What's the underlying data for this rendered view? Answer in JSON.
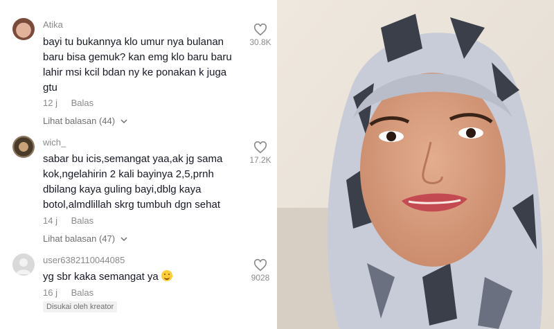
{
  "comments": [
    {
      "username": "Atika",
      "lines": [
        "bayi tu bukannya klo umur nya bulanan",
        "baru bisa gemuk? kan emg klo baru baru",
        "lahir msi kcil bdan ny ke ponakan k juga",
        "gtu"
      ],
      "time": "12 j",
      "reply_label": "Balas",
      "view_replies": "Lihat balasan (44)",
      "likes": "30.8K"
    },
    {
      "username": "wich_",
      "lines": [
        "sabar bu icis,semangat yaa,ak jg sama",
        "kok,ngelahirin 2 kali bayinya 2,5,prnh",
        "dbilang kaya guling bayi,dblg kaya",
        "botol,almdlillah skrg tumbuh dgn sehat"
      ],
      "time": "14 j",
      "reply_label": "Balas",
      "view_replies": "Lihat balasan (47)",
      "likes": "17.2K"
    },
    {
      "username": "user6382110044085",
      "lines": [
        "yg sbr kaka semangat ya"
      ],
      "emoji": "hugging-face-emoji",
      "time": "16 j",
      "reply_label": "Balas",
      "creator_badge": "Disukai oleh kreator",
      "likes": "9028"
    }
  ],
  "colors": {
    "username": "#8a8a8a",
    "text": "#161823",
    "meta": "#8a8a8a"
  },
  "photo": {
    "description": "woman in patterned hijab"
  }
}
